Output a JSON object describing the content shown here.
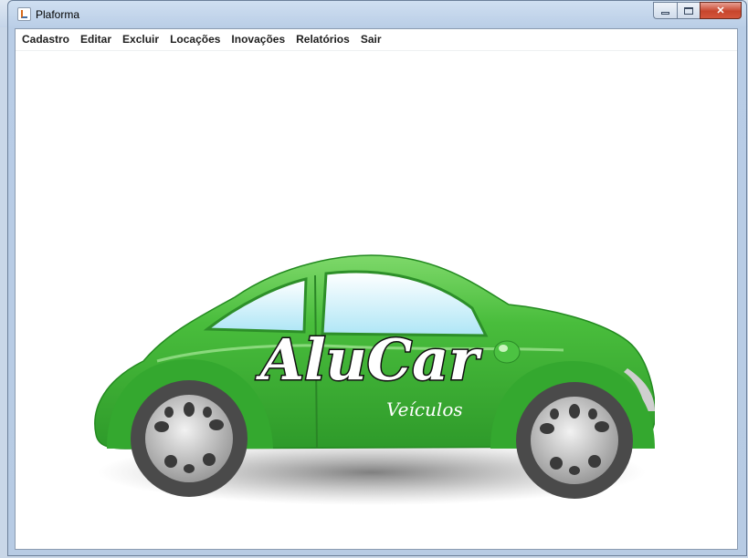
{
  "window": {
    "title": "Plaforma",
    "controls": {
      "minimize": "minimize",
      "maximize": "maximize",
      "close": "✕"
    }
  },
  "menu": [
    {
      "label": "Cadastro"
    },
    {
      "label": "Editar"
    },
    {
      "label": "Excluir"
    },
    {
      "label": "Locações"
    },
    {
      "label": "Inovações"
    },
    {
      "label": "Relatórios"
    },
    {
      "label": "Sair"
    }
  ],
  "logo": {
    "brand": "AluCar",
    "subtitle": "Veículos",
    "colors": {
      "body": "#3fb43a",
      "body_dark": "#2a8f27",
      "glass": "#c8eefa",
      "text": "#ffffff"
    }
  }
}
